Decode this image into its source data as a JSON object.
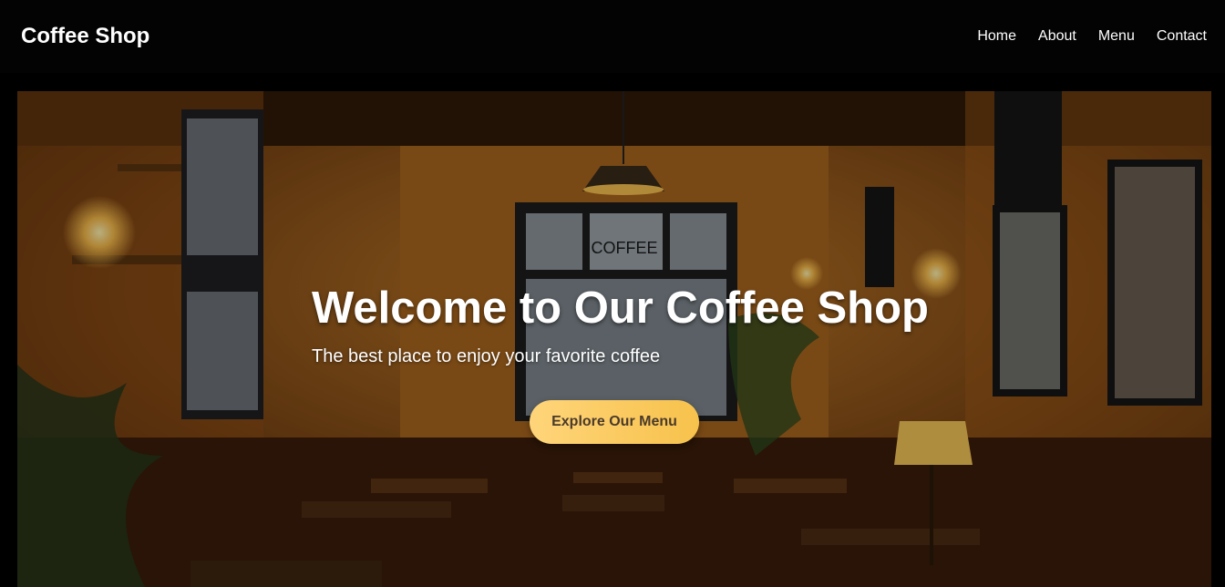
{
  "brand": {
    "name": "Coffee Shop"
  },
  "nav": {
    "items": [
      {
        "label": "Home"
      },
      {
        "label": "About"
      },
      {
        "label": "Menu"
      },
      {
        "label": "Contact"
      }
    ]
  },
  "hero": {
    "title": "Welcome to Our Coffee Shop",
    "subtitle": "The best place to enjoy your favorite coffee",
    "cta_label": "Explore Our Menu",
    "window_sign": "COFFEE"
  },
  "colors": {
    "nav_bg": "#030303",
    "cta_start": "#ffd57a",
    "cta_end": "#f7c24c",
    "cta_text": "#4a3a2a"
  }
}
